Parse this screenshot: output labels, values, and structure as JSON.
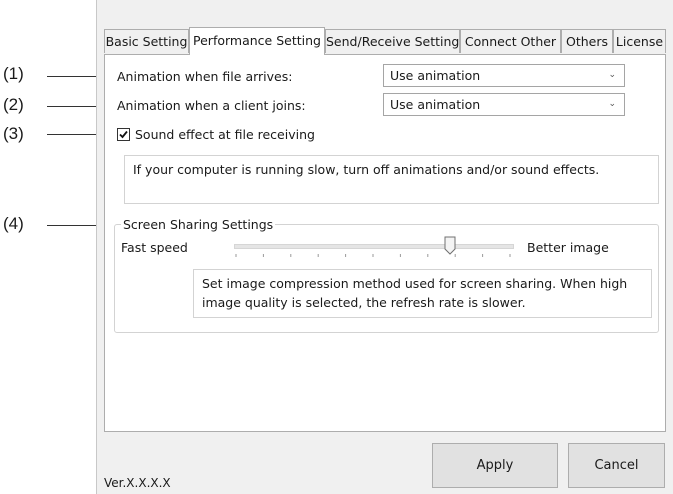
{
  "tabs": [
    {
      "label": "Basic Setting",
      "active": false
    },
    {
      "label": "Performance Setting",
      "active": true
    },
    {
      "label": "Send/Receive Setting",
      "active": false
    },
    {
      "label": "Connect Other",
      "active": false
    },
    {
      "label": "Others",
      "active": false
    },
    {
      "label": "License",
      "active": false
    }
  ],
  "callouts": [
    "(1)",
    "(2)",
    "(3)",
    "(4)"
  ],
  "settings": {
    "file_arrives_label": "Animation when file arrives:",
    "file_arrives_value": "Use animation",
    "client_joins_label": "Animation when a client  joins:",
    "client_joins_value": "Use animation",
    "sound_effect_label": "Sound effect at file receiving",
    "sound_effect_checked": true,
    "performance_note": "If your computer is running slow, turn off animations and/or sound effects."
  },
  "screen_sharing": {
    "group_title": "Screen Sharing Settings",
    "left_label": "Fast speed",
    "right_label": "Better image",
    "slider_position": 0.78,
    "note": "Set image compression method used for screen sharing. When high image quality is selected, the refresh rate is slower."
  },
  "footer": {
    "version": "Ver.X.X.X.X",
    "apply_label": "Apply",
    "cancel_label": "Cancel"
  },
  "colors": {
    "window_bg": "#f0f0f0",
    "panel_bg": "#ffffff",
    "border": "#adadad",
    "button_bg": "#e1e1e1"
  },
  "icons": {
    "checkbox": "check-icon",
    "dropdown": "chevron-down-icon",
    "slider_thumb": "slider-thumb-icon"
  }
}
